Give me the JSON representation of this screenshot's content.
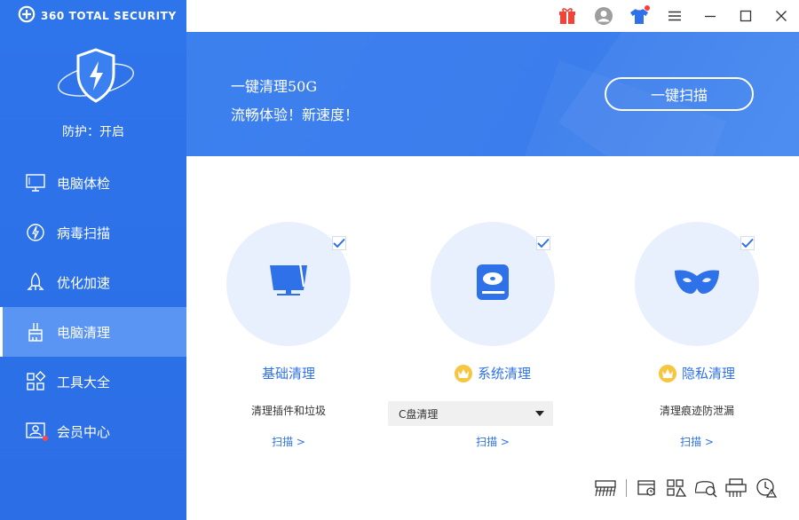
{
  "app": {
    "brand": "360 TOTAL SECURITY",
    "protection_status": "防护：开启"
  },
  "sidebar": {
    "items": [
      {
        "label": "电脑体检",
        "icon": "monitor-icon",
        "active": false
      },
      {
        "label": "病毒扫描",
        "icon": "virus-scan-icon",
        "active": false
      },
      {
        "label": "优化加速",
        "icon": "rocket-icon",
        "active": false
      },
      {
        "label": "电脑清理",
        "icon": "broom-icon",
        "active": true
      },
      {
        "label": "工具大全",
        "icon": "toolbox-icon",
        "active": false
      },
      {
        "label": "会员中心",
        "icon": "member-icon",
        "active": false
      }
    ]
  },
  "topbar": {
    "icons": [
      "gift-icon",
      "user-avatar-icon",
      "skin-shirt-icon",
      "menu-icon",
      "minimize-icon",
      "maximize-icon",
      "close-icon"
    ]
  },
  "banner": {
    "line1": "一键清理50G",
    "line2": "流畅体验！新速度！",
    "button_label": "一键扫描"
  },
  "cards": [
    {
      "title": "基础清理",
      "desc": "清理插件和垃圾",
      "link": "扫描 >",
      "icon": "monitor-clean-icon",
      "premium": false,
      "checked": true
    },
    {
      "title": "系统清理",
      "select_value": "C盘清理",
      "link": "扫描 >",
      "icon": "hard-drive-icon",
      "premium": true,
      "checked": true
    },
    {
      "title": "隐私清理",
      "desc": "清理痕迹防泄漏",
      "link": "扫描 >",
      "icon": "privacy-mask-icon",
      "premium": true,
      "checked": true
    }
  ],
  "tools": [
    "shredder-icon",
    "registry-icon",
    "system-slim-icon",
    "browser-clean-icon",
    "printer-clean-icon",
    "scheduled-clean-icon"
  ],
  "colors": {
    "sidebar": "#2e74ea",
    "sidebar_active": "#5a95f3",
    "accent": "#2f71e8",
    "banner": "#3c80ee",
    "circle_bg": "#e8f0fd",
    "crown": "#f7c641"
  }
}
